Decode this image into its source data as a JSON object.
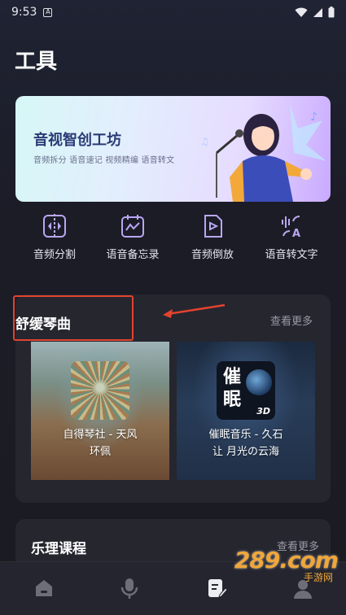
{
  "status_bar": {
    "time": "9:53",
    "notif_glyph": "A"
  },
  "page": {
    "title": "工具"
  },
  "banner": {
    "title": "音视智创工坊",
    "subtitle": "音频拆分 语音速记 视频精编 语音转文"
  },
  "tools": [
    {
      "label": "音频分割",
      "icon": "audio-split-icon"
    },
    {
      "label": "语音备忘录",
      "icon": "voice-memo-icon"
    },
    {
      "label": "音频倒放",
      "icon": "audio-reverse-icon"
    },
    {
      "label": "语音转文字",
      "icon": "speech-to-text-icon"
    }
  ],
  "soothing": {
    "title": "舒缓琴曲",
    "more": "查看更多",
    "items": [
      {
        "line1": "自得琴社 - 天风",
        "line2": "环佩"
      },
      {
        "line1": "催眠音乐 - 久石",
        "line2": "让 月光の云海",
        "thumb_text": "催眠",
        "thumb_badge": "3D"
      }
    ]
  },
  "theory": {
    "title": "乐理课程",
    "more": "查看更多"
  },
  "bottom_nav": [
    {
      "icon": "home-icon"
    },
    {
      "icon": "microphone-icon"
    },
    {
      "icon": "document-edit-icon"
    },
    {
      "icon": "profile-icon"
    }
  ],
  "watermark": {
    "brand": "289.com",
    "sub": "手游网"
  },
  "colors": {
    "accent_red": "#e2432f",
    "banner_title": "#2a3a75",
    "card_bg": "#26262f"
  }
}
